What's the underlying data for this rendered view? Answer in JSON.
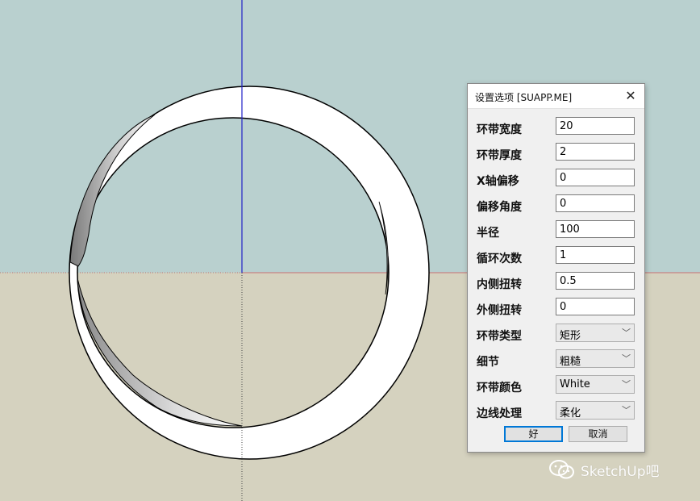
{
  "colors": {
    "sky": "#b9d0cf",
    "ground": "#d5d2bf",
    "blue_axis": "#2020c8",
    "red_axis": "#c87070"
  },
  "dialog": {
    "title": "设置选项 [SUAPP.ME]",
    "close_icon": "close-icon",
    "fields": [
      {
        "label": "环带宽度",
        "value": "20"
      },
      {
        "label": "环带厚度",
        "value": "2"
      },
      {
        "label": "X轴偏移",
        "value": "0"
      },
      {
        "label": "偏移角度",
        "value": "0"
      },
      {
        "label": "半径",
        "value": "100"
      },
      {
        "label": "循环次数",
        "value": "1"
      },
      {
        "label": "内侧扭转",
        "value": "0.5"
      },
      {
        "label": "外侧扭转",
        "value": "0"
      }
    ],
    "selects": [
      {
        "label": "环带类型",
        "value": "矩形"
      },
      {
        "label": "细节",
        "value": "粗糙"
      },
      {
        "label": "环带颜色",
        "value": "White"
      },
      {
        "label": "边线处理",
        "value": "柔化"
      }
    ],
    "ok_label": "好",
    "cancel_label": "取消"
  },
  "watermark": {
    "icon": "wechat-icon",
    "text": "SketchUp吧"
  }
}
